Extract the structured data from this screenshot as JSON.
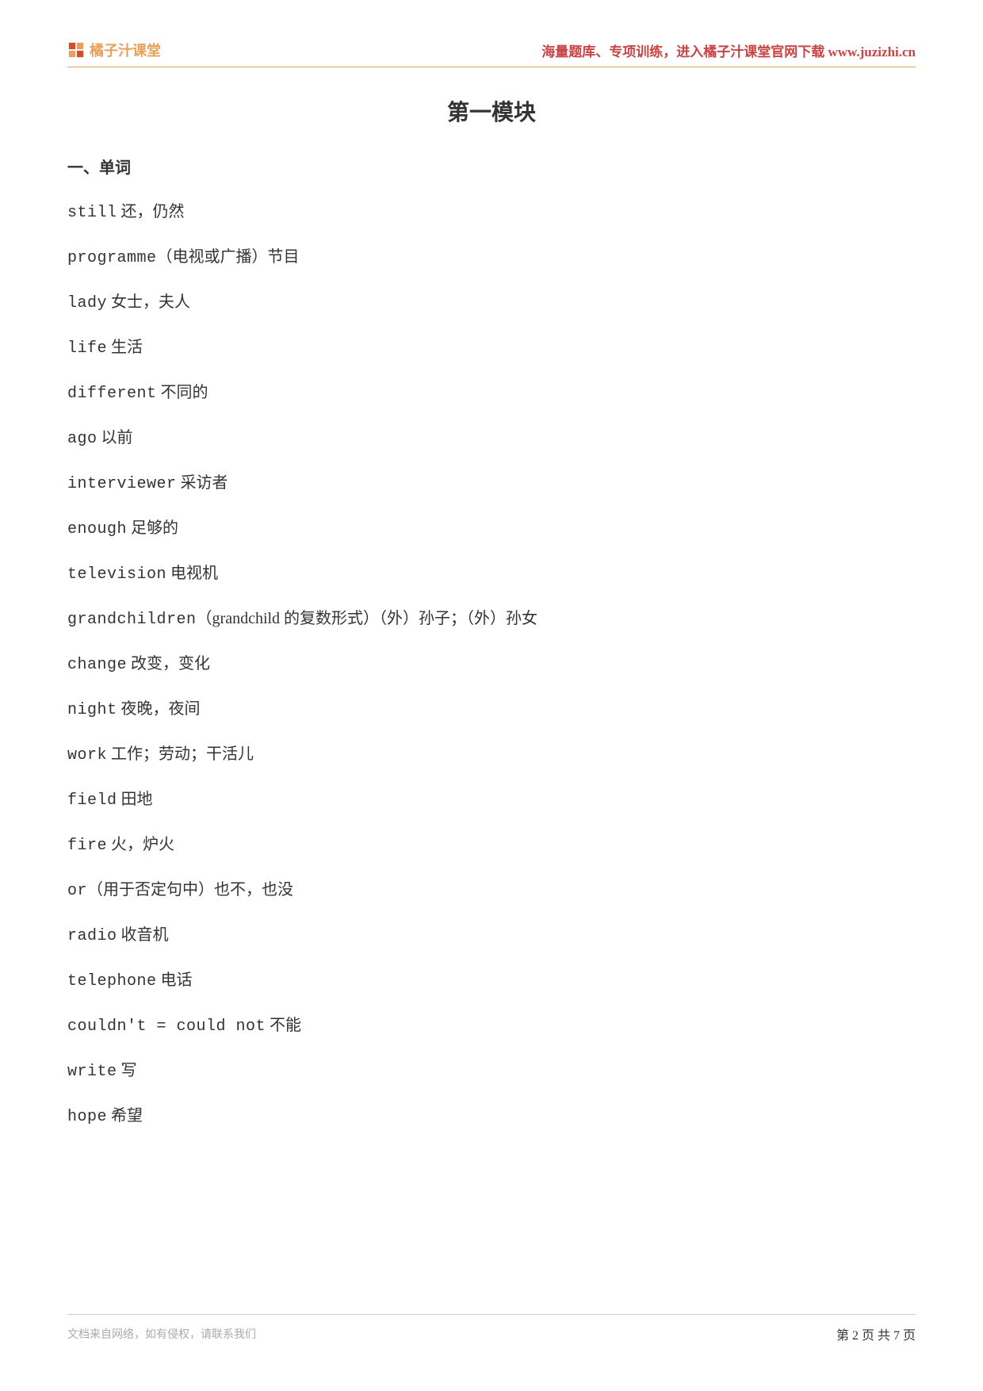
{
  "header": {
    "logo_text": "橘子汁课堂",
    "right_text": "海量题库、专项训练，进入橘子汁课堂官网下载 www.juzizhi.cn"
  },
  "module_title": "第一模块",
  "section_title": "一、单词",
  "vocab": [
    {
      "eng": "still",
      "chn": " 还，仍然"
    },
    {
      "eng": "programme",
      "chn": "（电视或广播）节目"
    },
    {
      "eng": "lady",
      "chn": " 女士，夫人"
    },
    {
      "eng": "life",
      "chn": " 生活"
    },
    {
      "eng": "different",
      "chn": " 不同的"
    },
    {
      "eng": "ago",
      "chn": " 以前"
    },
    {
      "eng": "interviewer",
      "chn": " 采访者"
    },
    {
      "eng": "enough",
      "chn": " 足够的"
    },
    {
      "eng": "television",
      "chn": " 电视机"
    },
    {
      "eng": "grandchildren",
      "chn": "（grandchild 的复数形式）（外）孙子；（外）孙女"
    },
    {
      "eng": "change",
      "chn": " 改变，变化"
    },
    {
      "eng": "night",
      "chn": " 夜晚，夜间"
    },
    {
      "eng": "work",
      "chn": " 工作；劳动；干活儿"
    },
    {
      "eng": "field",
      "chn": " 田地"
    },
    {
      "eng": "fire",
      "chn": " 火，炉火"
    },
    {
      "eng": "or",
      "chn": "（用于否定句中）也不，也没"
    },
    {
      "eng": "radio",
      "chn": " 收音机"
    },
    {
      "eng": "telephone",
      "chn": " 电话"
    },
    {
      "eng": "couldn't = could not",
      "chn": " 不能"
    },
    {
      "eng": "write",
      "chn": " 写"
    },
    {
      "eng": "hope",
      "chn": " 希望"
    }
  ],
  "footer": {
    "left": "文档来自网络，如有侵权，请联系我们",
    "right": "第 2 页 共 7 页"
  }
}
